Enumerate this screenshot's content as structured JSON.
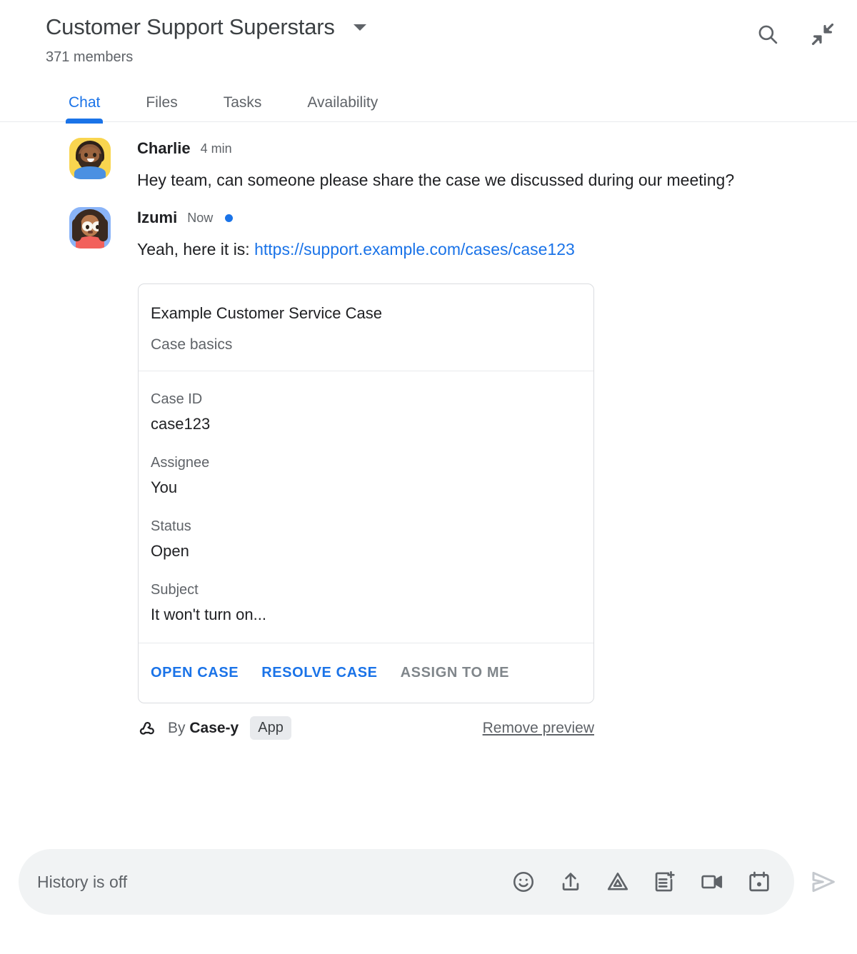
{
  "header": {
    "title": "Customer Support Superstars",
    "members": "371 members",
    "caret_icon": "chevron-down-icon",
    "actions": [
      {
        "name": "search-icon",
        "label": "Search"
      },
      {
        "name": "collapse-icon",
        "label": "Collapse"
      }
    ]
  },
  "tabs": [
    {
      "label": "Chat",
      "active": true
    },
    {
      "label": "Files",
      "active": false
    },
    {
      "label": "Tasks",
      "active": false
    },
    {
      "label": "Availability",
      "active": false
    }
  ],
  "messages": [
    {
      "author": "Charlie",
      "time": "4 min",
      "unread": false,
      "text": "Hey team, can someone please share the case we discussed during our meeting?",
      "avatar": "charlie-avatar"
    },
    {
      "author": "Izumi",
      "time": "Now",
      "unread": true,
      "text_prefix": "Yeah, here it is: ",
      "link_text": "https://support.example.com/cases/case123",
      "avatar": "izumi-avatar"
    }
  ],
  "card": {
    "title": "Example Customer Service Case",
    "subtitle": "Case basics",
    "fields": [
      {
        "label": "Case ID",
        "value": "case123"
      },
      {
        "label": "Assignee",
        "value": "You"
      },
      {
        "label": "Status",
        "value": "Open"
      },
      {
        "label": "Subject",
        "value": "It won't turn on..."
      }
    ],
    "buttons": [
      {
        "label": "OPEN CASE",
        "enabled": true
      },
      {
        "label": "RESOLVE CASE",
        "enabled": true
      },
      {
        "label": "ASSIGN TO ME",
        "enabled": false
      }
    ]
  },
  "attribution": {
    "icon": "webhook-icon",
    "by_text": "By ",
    "app_name": "Case-y",
    "chip": "App",
    "remove_label": "Remove preview"
  },
  "composer": {
    "placeholder": "History is off",
    "icons": [
      "emoji-icon",
      "upload-icon",
      "drive-icon",
      "doc-add-icon",
      "video-icon",
      "calendar-icon"
    ],
    "send_icon": "send-icon"
  },
  "colors": {
    "accent": "#1a73e8",
    "text_primary": "#202124",
    "text_secondary": "#5f6368",
    "border": "#dadce0",
    "composer_bg": "#f1f3f4",
    "chip_bg": "#e8eaed"
  }
}
